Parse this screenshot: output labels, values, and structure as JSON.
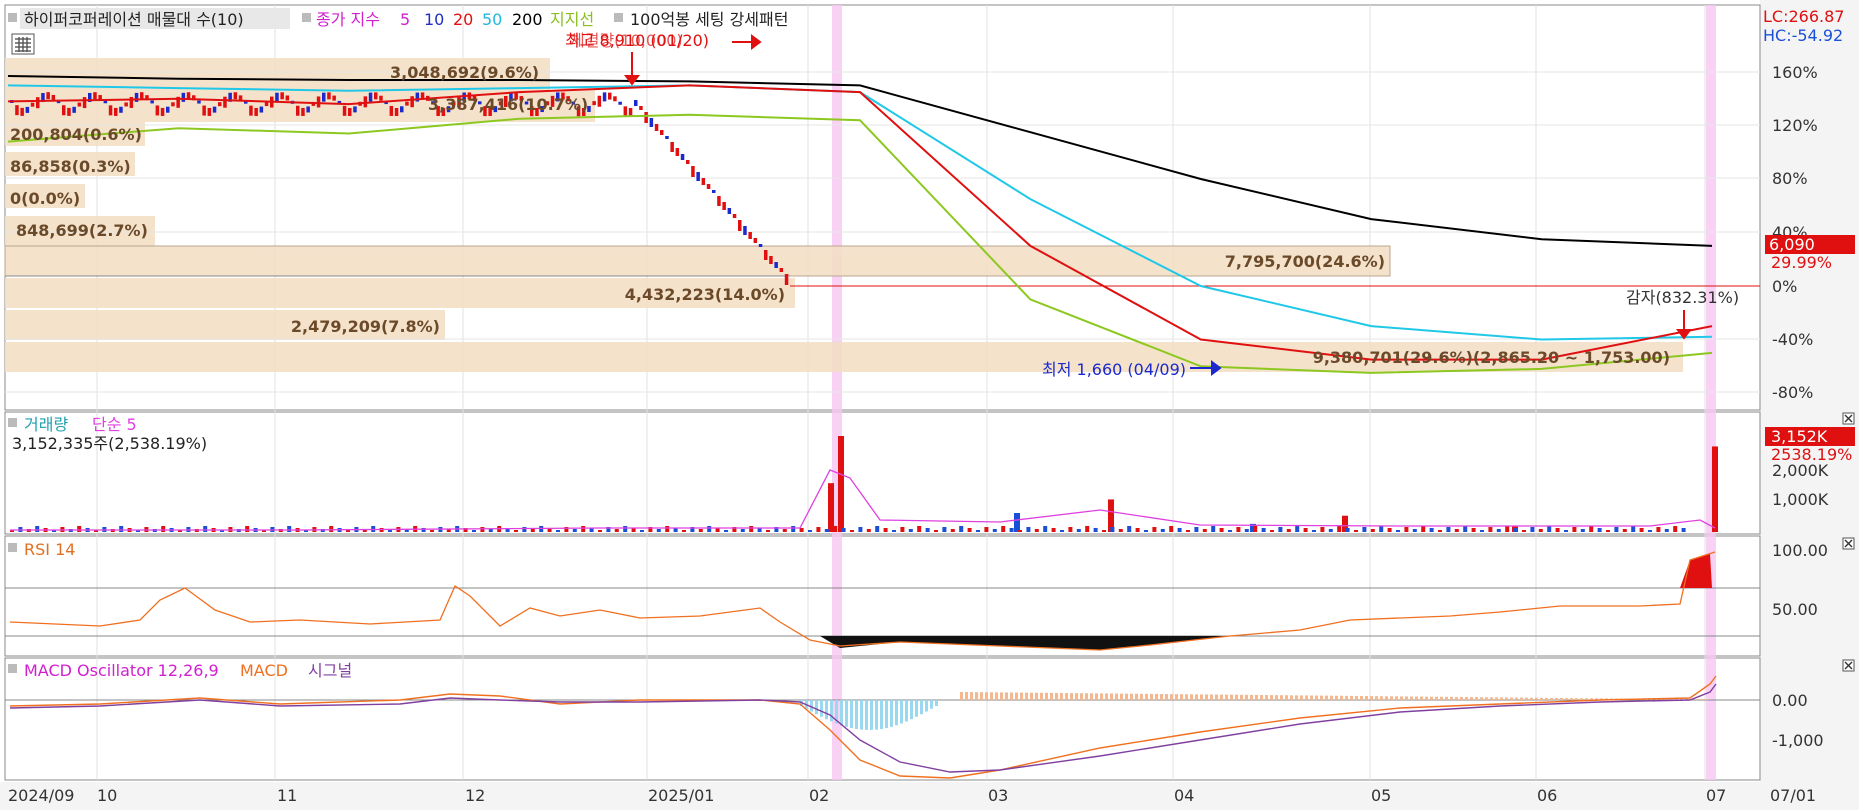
{
  "main_legend": {
    "indicator": "하이퍼코퍼레이션 매물대 수(10)",
    "ma_label": "종가 지수",
    "ma_periods": [
      "5",
      "10",
      "20",
      "50",
      "200"
    ],
    "ma_colors": [
      "#e040e0",
      "#2030c0",
      "#e01010",
      "#20c8e8",
      "#000000"
    ],
    "support_label": "지지선",
    "setting_label": "100억봉 세팅 강세패턴"
  },
  "header_right": {
    "lc": "LC:266.87",
    "hc": "HC:-54.92"
  },
  "price_axis": [
    "160%",
    "120%",
    "80%",
    "40%",
    "0%",
    "-40%",
    "-80%"
  ],
  "price_badge": {
    "value": "6,090",
    "pct": "29.99%"
  },
  "volume_profile": [
    {
      "label": "3,048,692(9.6%)"
    },
    {
      "label": "3,387,416(10.7%)"
    },
    {
      "label": "200,804(0.6%)"
    },
    {
      "label": "86,858(0.3%)"
    },
    {
      "label": "0(0.0%)"
    },
    {
      "label": "848,699(2.7%)"
    },
    {
      "label": "7,795,700(24.6%)"
    },
    {
      "label": "4,432,223(14.0%)"
    },
    {
      "label": "2,479,209(7.8%)"
    },
    {
      "label": "9,380,701(29.6%)(2,865.20 ~ 1,753.00)"
    }
  ],
  "annotations": {
    "highest": "최고 8,910 (01/20)",
    "overlap": "체결량(10,000)",
    "lowest": "최저 1,660 (04/09)",
    "audit": "감자(832.31%)"
  },
  "volume_panel": {
    "legend": "거래량",
    "ma_legend": "단순 5",
    "current": "3,152,335주(2,538.19%)",
    "axis": [
      "2,000K",
      "1,000K"
    ],
    "badge": "3,152K",
    "badge_pct": "2538.19%"
  },
  "rsi_panel": {
    "legend": "RSI 14",
    "axis": [
      "100.00",
      "50.00"
    ]
  },
  "macd_panel": {
    "legend": "MACD Oscillator 12,26,9",
    "macd": "MACD",
    "signal": "시그널",
    "axis": [
      "0.00",
      "-1,000"
    ]
  },
  "x_axis": {
    "labels": [
      "2024/09",
      "10",
      "11",
      "12",
      "2025/01",
      "02",
      "03",
      "04",
      "05",
      "06",
      "07"
    ],
    "right": "07/01"
  },
  "chart_data": [
    {
      "type": "line",
      "title": "하이퍼코퍼레이션 price (% scale)",
      "x": [
        "2024/09",
        "10",
        "11",
        "12",
        "2025/01",
        "02",
        "03",
        "04",
        "05",
        "06",
        "07"
      ],
      "ylim": [
        -80,
        160
      ],
      "series": [
        {
          "name": "200",
          "values": [
            157,
            155,
            154,
            154,
            153,
            150,
            115,
            80,
            50,
            35,
            30
          ]
        },
        {
          "name": "50",
          "values": [
            150,
            148,
            146,
            148,
            150,
            145,
            65,
            0,
            -30,
            -40,
            -38
          ]
        },
        {
          "name": "20",
          "values": [
            138,
            140,
            136,
            145,
            150,
            145,
            30,
            -40,
            -55,
            -55,
            -30
          ]
        },
        {
          "name": "support",
          "values": [
            108,
            118,
            114,
            125,
            128,
            124,
            -10,
            -60,
            -65,
            -62,
            -50
          ]
        }
      ]
    },
    {
      "type": "bar",
      "title": "거래량",
      "categories": [
        "02",
        "02",
        "03",
        "03",
        "04",
        "05",
        "06",
        "07"
      ],
      "values": [
        1800,
        3600,
        700,
        1200,
        300,
        600,
        200,
        3152
      ],
      "ylim": [
        0,
        3500
      ]
    },
    {
      "type": "line",
      "title": "RSI 14",
      "x": [
        "2024/09",
        "10",
        "11",
        "12",
        "2025/01",
        "02",
        "03",
        "04",
        "05",
        "06",
        "07"
      ],
      "ylim": [
        0,
        100
      ],
      "series": [
        {
          "name": "RSI",
          "values": [
            40,
            60,
            40,
            70,
            45,
            15,
            15,
            20,
            40,
            50,
            95
          ]
        }
      ]
    },
    {
      "type": "line",
      "title": "MACD Oscillator 12,26,9",
      "x": [
        "2024/09",
        "10",
        "11",
        "12",
        "2025/01",
        "02",
        "03",
        "04",
        "05",
        "06",
        "07"
      ],
      "series": [
        {
          "name": "MACD",
          "values": [
            0,
            40,
            -20,
            60,
            0,
            -800,
            -1200,
            -600,
            -250,
            -50,
            300
          ]
        },
        {
          "name": "시그널",
          "values": [
            0,
            20,
            -10,
            40,
            10,
            -500,
            -1150,
            -800,
            -350,
            -80,
            150
          ]
        }
      ]
    }
  ]
}
